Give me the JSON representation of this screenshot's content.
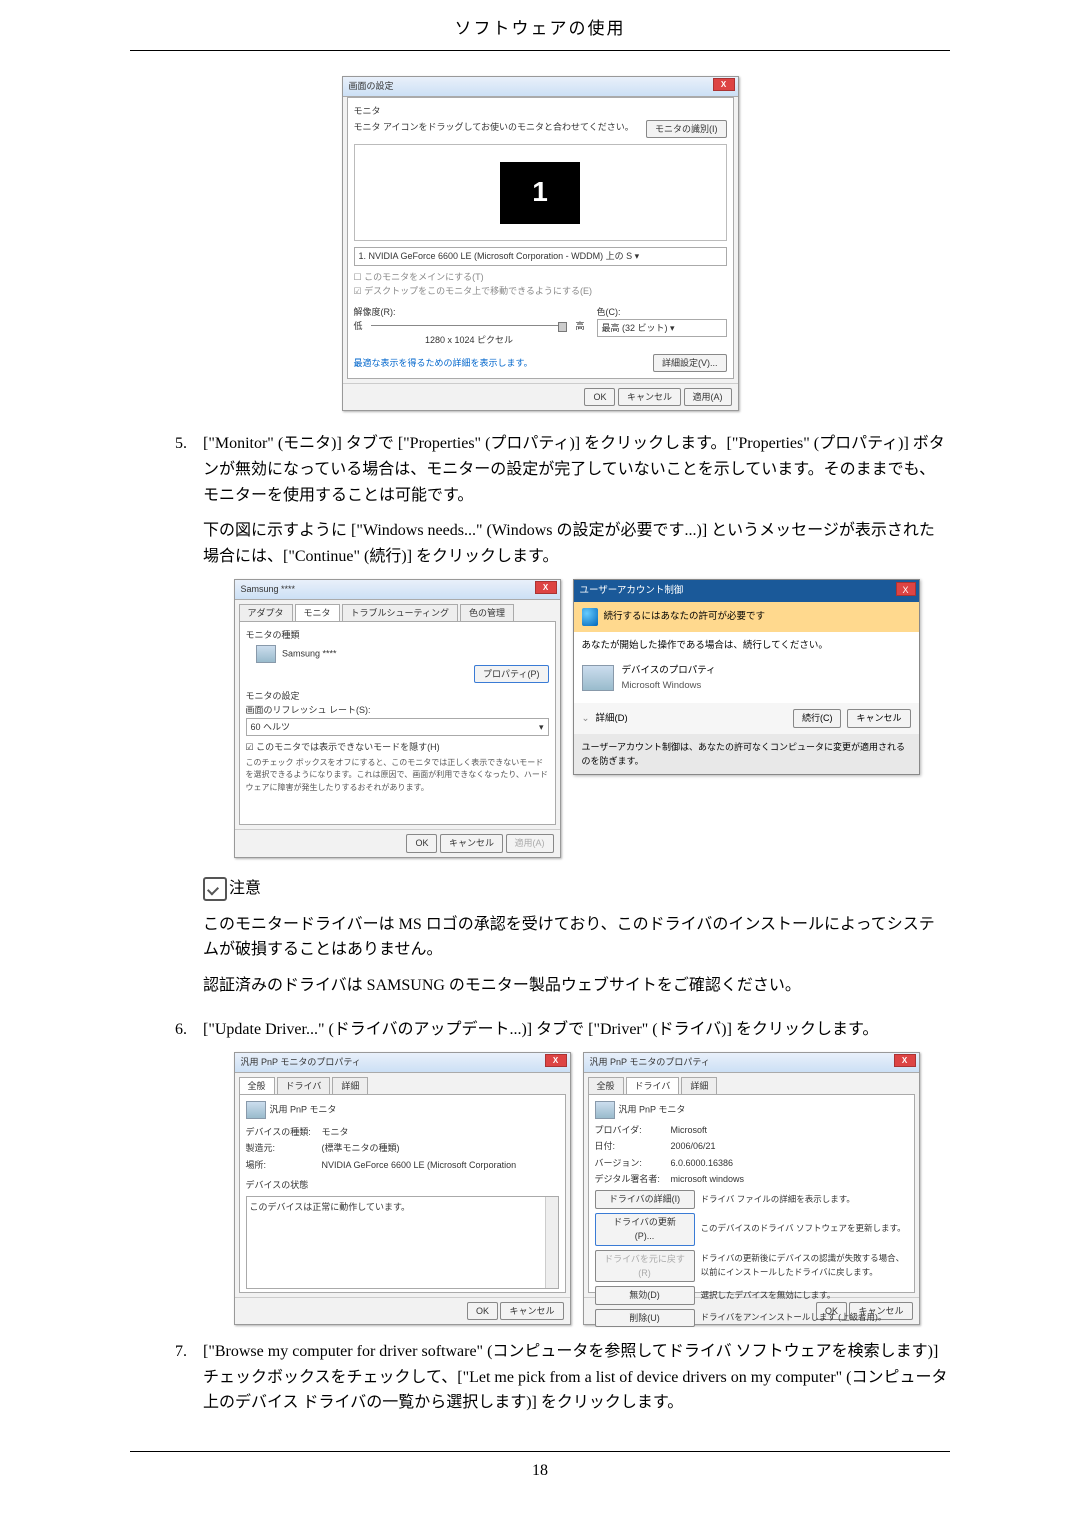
{
  "page": {
    "header_title": "ソフトウェアの使用",
    "number": "18"
  },
  "fig1": {
    "title": "画面の設定",
    "section_label": "モニタ",
    "drag_text": "モニタ アイコンをドラッグしてお使いのモニタと合わせてください。",
    "identify_btn": "モニタの識別(I)",
    "monitor_number": "1",
    "adapter_line": "1. NVIDIA GeForce 6600 LE (Microsoft Corporation - WDDM) 上の S ▾",
    "cb_main": "このモニタをメインにする(T)",
    "cb_extend": "デスクトップをこのモニタ上で移動できるようにする(E)",
    "res_label": "解像度(R):",
    "res_low": "低",
    "res_high": "高",
    "res_value": "1280 x 1024 ピクセル",
    "color_label": "色(C):",
    "color_value": "最高 (32 ビット) ▾",
    "adv_link": "最適な表示を得るための詳細を表示します。",
    "adv_btn": "詳細設定(V)...",
    "ok": "OK",
    "cancel": "キャンセル",
    "apply": "適用(A)"
  },
  "step5": {
    "num": "5.",
    "p1": "[\"Monitor\" (モニタ)] タブで [\"Properties\" (プロパティ)] をクリックします。[\"Properties\" (プロパティ)] ボタンが無効になっている場合は、モニターの設定が完了していないことを示しています。そのままでも、モニターを使用することは可能です。",
    "p2": "下の図に示すように [\"Windows needs...\" (Windows の設定が必要です...)] というメッセージが表示された場合には、[\"Continue\" (続行)] をクリックします。"
  },
  "fig2_left": {
    "title": "Samsung ****",
    "tab_adapter": "アダプタ",
    "tab_monitor": "モニタ",
    "tab_trouble": "トラブルシューティング",
    "tab_color": "色の管理",
    "grp_type": "モニタの種類",
    "name": "Samsung ****",
    "prop_btn": "プロパティ(P)",
    "grp_set": "モニタの設定",
    "refresh_lbl": "画面のリフレッシュ レート(S):",
    "refresh_val": "60 ヘルツ",
    "cb_hide": "このモニタでは表示できないモードを隠す(H)",
    "note": "このチェック ボックスをオフにすると、このモニタでは正しく表示できないモードを選択できるようになります。これは原因で、画面が利用できなくなったり、ハードウェアに障害が発生したりするおそれがあります。",
    "ok": "OK",
    "cancel": "キャンセル",
    "apply": "適用(A)"
  },
  "fig2_uac": {
    "title": "ユーザーアカウント制御",
    "band": "続行するにはあなたの許可が必要です",
    "line1": "あなたが開始した操作である場合は、続行してください。",
    "device": "デバイスのプロパティ",
    "publisher": "Microsoft Windows",
    "details": "詳細(D)",
    "continue": "続行(C)",
    "cancel": "キャンセル",
    "footer": "ユーザーアカウント制御は、あなたの許可なくコンピュータに変更が適用されるのを防ぎます。"
  },
  "note": {
    "label": "注意",
    "p1": "このモニタードライバーは MS ロゴの承認を受けており、このドライバのインストールによってシステムが破損することはありません。",
    "p2": "認証済みのドライバは SAMSUNG のモニター製品ウェブサイトをご確認ください。"
  },
  "step6": {
    "num": "6.",
    "text": "[\"Update Driver...\" (ドライバのアップデート...)] タブで [\"Driver\" (ドライバ)] をクリックします。"
  },
  "fig3_left": {
    "title": "汎用 PnP モニタのプロパティ",
    "tab_general": "全般",
    "tab_driver": "ドライバ",
    "tab_detail": "詳細",
    "device": "汎用 PnP モニタ",
    "l_type": "デバイスの種類:",
    "v_type": "モニタ",
    "l_mfr": "製造元:",
    "v_mfr": "(標準モニタの種類)",
    "l_loc": "場所:",
    "v_loc": "NVIDIA GeForce 6600 LE (Microsoft Corporation",
    "grp_status": "デバイスの状態",
    "status": "このデバイスは正常に動作しています。",
    "ok": "OK",
    "cancel": "キャンセル"
  },
  "fig3_right": {
    "title": "汎用 PnP モニタのプロパティ",
    "tab_general": "全般",
    "tab_driver": "ドライバ",
    "tab_detail": "詳細",
    "device": "汎用 PnP モニタ",
    "l_provider": "プロバイダ:",
    "v_provider": "Microsoft",
    "l_date": "日付:",
    "v_date": "2006/06/21",
    "l_ver": "バージョン:",
    "v_ver": "6.0.6000.16386",
    "l_signer": "デジタル署名者:",
    "v_signer": "microsoft windows",
    "b_detail": "ドライバの詳細(I)",
    "d_detail": "ドライバ ファイルの詳細を表示します。",
    "b_update": "ドライバの更新(P)...",
    "d_update": "このデバイスのドライバ ソフトウェアを更新します。",
    "b_roll": "ドライバを元に戻す(R)",
    "d_roll": "ドライバの更新後にデバイスの認識が失敗する場合、以前にインストールしたドライバに戻します。",
    "b_disable": "無効(D)",
    "d_disable": "選択したデバイスを無効にします。",
    "b_uninstall": "削除(U)",
    "d_uninstall": "ドライバをアンインストールします (上級者用)。",
    "ok": "OK",
    "cancel": "キャンセル"
  },
  "step7": {
    "num": "7.",
    "text": "[\"Browse my computer for driver software\" (コンピュータを参照してドライバ ソフトウェアを検索します)] チェックボックスをチェックして、[\"Let me pick from a list of device drivers on my computer\" (コンピュータ上のデバイス ドライバの一覧から選択します)] をクリックします。"
  }
}
